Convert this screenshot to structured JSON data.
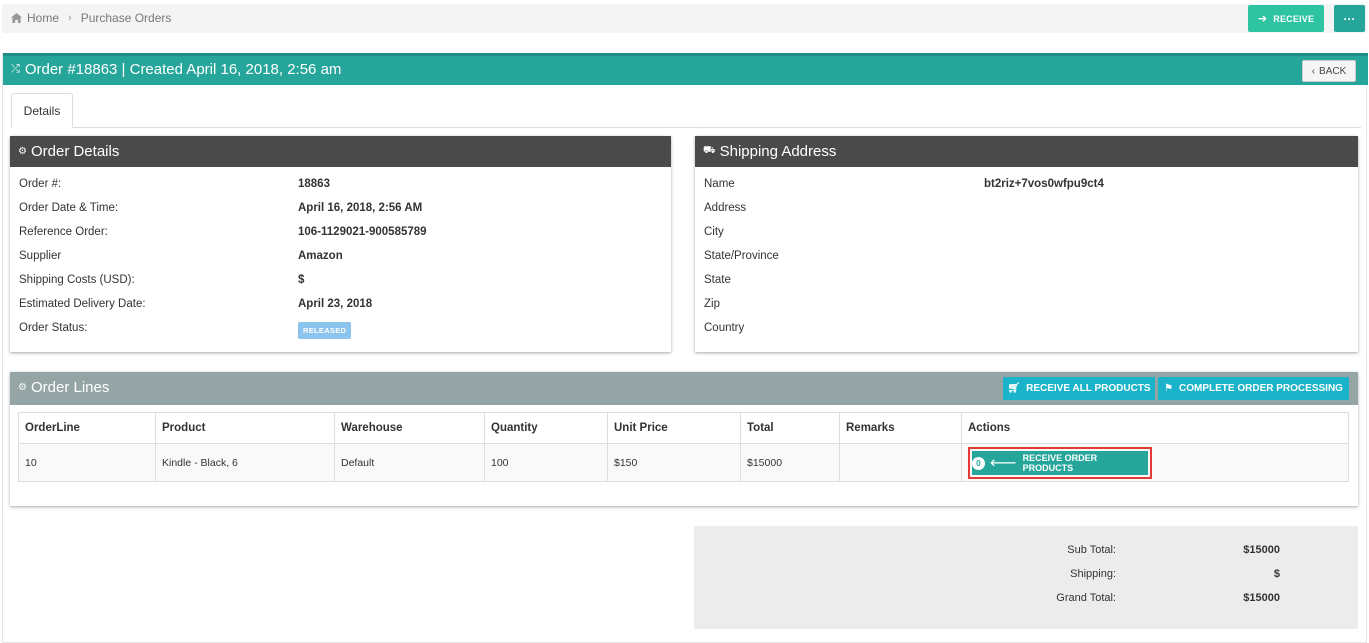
{
  "breadcrumb": {
    "home": "Home",
    "current": "Purchase Orders"
  },
  "top_actions": {
    "receive_label": "RECEIVE",
    "more_label": "···"
  },
  "order_header": {
    "title": "Order #18863 | Created April 16, 2018, 2:56 am",
    "back_label": "BACK"
  },
  "tabs": [
    {
      "label": "Details"
    }
  ],
  "order_details": {
    "title": "Order Details",
    "rows": [
      {
        "label": "Order #:",
        "value": "18863"
      },
      {
        "label": "Order Date & Time:",
        "value": "April 16, 2018, 2:56 AM"
      },
      {
        "label": "Reference Order:",
        "value": "106-1129021-900585789"
      },
      {
        "label": "Supplier",
        "value": "Amazon"
      },
      {
        "label": "Shipping Costs (USD):",
        "value": "$"
      },
      {
        "label": "Estimated Delivery Date:",
        "value": "April 23, 2018"
      },
      {
        "label": "Order Status:",
        "value": "RELEASED"
      }
    ]
  },
  "shipping_address": {
    "title": "Shipping Address",
    "rows": [
      {
        "label": "Name",
        "value": "bt2riz+7vos0wfpu9ct4"
      },
      {
        "label": "Address",
        "value": ""
      },
      {
        "label": "City",
        "value": ""
      },
      {
        "label": "State/Province",
        "value": ""
      },
      {
        "label": "State",
        "value": ""
      },
      {
        "label": "Zip",
        "value": ""
      },
      {
        "label": "Country",
        "value": ""
      }
    ]
  },
  "order_lines": {
    "title": "Order Lines",
    "receive_all_label": "RECEIVE ALL PRODUCTS",
    "complete_label": "COMPLETE ORDER PROCESSING",
    "columns": [
      "OrderLine",
      "Product",
      "Warehouse",
      "Quantity",
      "Unit Price",
      "Total",
      "Remarks",
      "Actions"
    ],
    "rows": [
      {
        "orderline": "10",
        "product": "Kindle - Black, 6",
        "warehouse": "Default",
        "quantity": "100",
        "unit_price": "$150",
        "total": "$15000",
        "remarks": "",
        "action_count": "0",
        "action_label": "RECEIVE ORDER PRODUCTS"
      }
    ]
  },
  "totals": {
    "sub_total_label": "Sub Total:",
    "sub_total": "$15000",
    "shipping_label": "Shipping:",
    "shipping": "$",
    "grand_total_label": "Grand Total:",
    "grand_total": "$15000"
  },
  "colors": {
    "primary": "#26a69a",
    "success": "#2ec4a1",
    "info": "#1bb3c9",
    "dark_header": "#4a4a4a",
    "grey_header": "#95a5a6",
    "badge": "#8bc4ec",
    "highlight": "#e53935"
  }
}
